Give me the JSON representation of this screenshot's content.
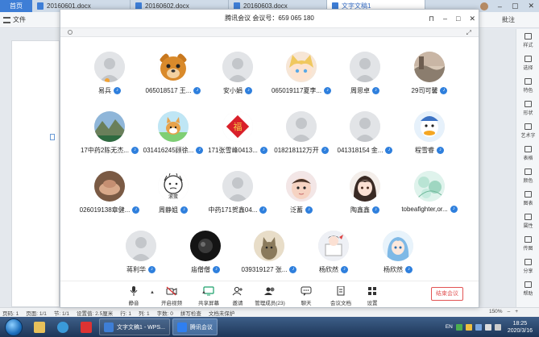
{
  "wps": {
    "home_tab": "首页",
    "doc_tabs": [
      "20160601.docx",
      "20160602.docx",
      "20160603.docx",
      "文字文稿1"
    ],
    "file_menu": "文件",
    "approve_label": "批注",
    "sidebar": [
      "样式",
      "选择",
      "特色",
      "形状",
      "艺术字",
      "表格",
      "颜色",
      "图表",
      "属性",
      "传图",
      "分享",
      "帮助"
    ],
    "status": [
      "页码: 1",
      "页面: 1/1",
      "节: 1/1",
      "设置值: 2.5厘米",
      "行: 1",
      "列: 1",
      "字数: 0",
      "拼写检查",
      "文档未保护"
    ],
    "zoom": "150%"
  },
  "taskbar": {
    "tasks": [
      {
        "label": "文字文稿1 - WPS...",
        "active": false,
        "color": "#3e7ed6"
      },
      {
        "label": "腾讯会议",
        "active": true,
        "color": "#2f7ff0"
      }
    ],
    "tray_lang": "EN",
    "time": "18:25",
    "date": "2020/3/16"
  },
  "meeting": {
    "title": "腾讯会议  会议号：659 065 180",
    "participants": [
      {
        "name": "易兵",
        "avatar": "default-avatar",
        "mic": "speaking-mic-icon"
      },
      {
        "name": "065018517 王...",
        "avatar": "cartoon-bear-avatar"
      },
      {
        "name": "安小娟",
        "avatar": "default-avatar"
      },
      {
        "name": "065019117夏李...",
        "avatar": "anime-cat-girl-avatar"
      },
      {
        "name": "周思卓",
        "avatar": "default-avatar"
      },
      {
        "name": "29司可馨",
        "avatar": "landscape-photo-avatar"
      },
      {
        "name": "17中药2陈无杰...",
        "avatar": "mountain-photo-avatar"
      },
      {
        "name": "031416245顾徐...",
        "avatar": "corgi-dog-avatar"
      },
      {
        "name": "171张雪峰0413...",
        "avatar": "red-fu-avatar"
      },
      {
        "name": "018218112万开",
        "avatar": "default-avatar"
      },
      {
        "name": "041318154 金...",
        "avatar": "default-avatar"
      },
      {
        "name": "程雪睿",
        "avatar": "donald-duck-avatar"
      },
      {
        "name": "026019138章健...",
        "avatar": "hands-photo-avatar"
      },
      {
        "name": "周静姐",
        "avatar": "sketch-face-avatar",
        "avatar_text": "滚蛋"
      },
      {
        "name": "中药171贺鑫04...",
        "avatar": "default-avatar"
      },
      {
        "name": "泛蓄",
        "avatar": "baby-photo-avatar"
      },
      {
        "name": "陶鑫鑫",
        "avatar": "anime-girl-avatar"
      },
      {
        "name": "tobeafighter,or...",
        "avatar": "floral-art-avatar"
      },
      {
        "name": "蒋利华",
        "avatar": "default-avatar"
      },
      {
        "name": "庙僧僧",
        "avatar": "dark-night-avatar"
      },
      {
        "name": "039319127 张...",
        "avatar": "cat-photo-avatar"
      },
      {
        "name": "杨欣然",
        "avatar": "cartoon-girl-avatar"
      },
      {
        "name": "杨欣然",
        "avatar": "anime-blue-avatar"
      }
    ],
    "toolbar": [
      {
        "label": "静音",
        "icon": "microphone-icon"
      },
      {
        "label": "开启视频",
        "icon": "camera-off-icon"
      },
      {
        "label": "共享屏幕",
        "icon": "screen-share-icon"
      },
      {
        "label": "邀请",
        "icon": "invite-icon"
      },
      {
        "label": "管理成员(23)",
        "icon": "members-icon"
      },
      {
        "label": "聊天",
        "icon": "chat-icon"
      },
      {
        "label": "会议文档",
        "icon": "document-icon"
      },
      {
        "label": "设置",
        "icon": "settings-icon"
      }
    ],
    "end_button": "结束会议"
  }
}
